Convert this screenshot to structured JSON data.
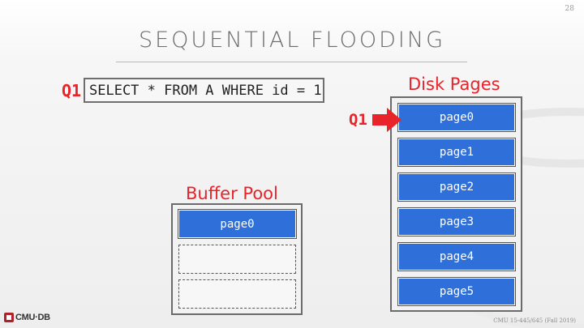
{
  "slide": {
    "page_number": "28",
    "title": "SEQUENTIAL FLOODING"
  },
  "query": {
    "label": "Q1",
    "text": "SELECT * FROM A WHERE id = 1"
  },
  "disk": {
    "label": "Disk Pages",
    "pointer_label": "Q1",
    "pages": [
      "page0",
      "page1",
      "page2",
      "page3",
      "page4",
      "page5"
    ]
  },
  "buffer_pool": {
    "label": "Buffer Pool",
    "pages": [
      "page0",
      "",
      ""
    ]
  },
  "footer": {
    "logo_text": "CMU·DB",
    "course": "CMU 15-445/645 (Fall 2019)"
  },
  "colors": {
    "accent_red": "#e8232a",
    "page_blue": "#2f6fd9"
  },
  "icons": [
    "right-arrow-icon",
    "database-cylinder-icon",
    "cmu-db-logo-icon"
  ]
}
